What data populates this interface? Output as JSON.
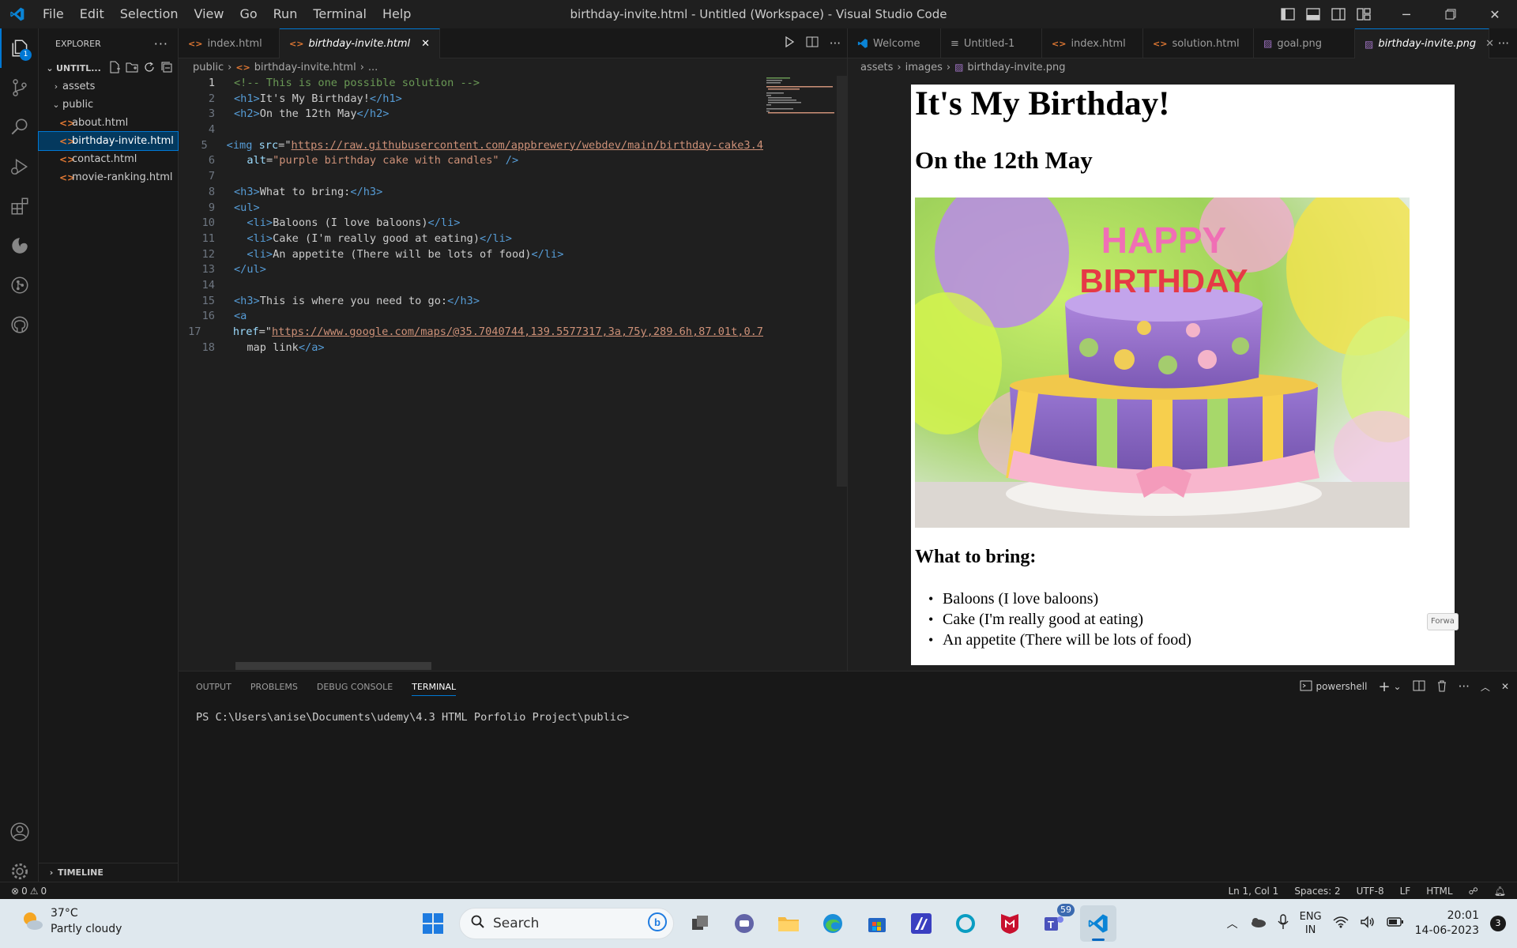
{
  "window": {
    "title": "birthday-invite.html - Untitled (Workspace) - Visual Studio Code",
    "menu": [
      "File",
      "Edit",
      "Selection",
      "View",
      "Go",
      "Run",
      "Terminal",
      "Help"
    ]
  },
  "activity": {
    "explorer_badge": "1"
  },
  "sidebar": {
    "title": "EXPLORER",
    "workspace": "UNTITL...",
    "tree": [
      {
        "label": "assets",
        "type": "folder"
      },
      {
        "label": "public",
        "type": "folder-open"
      },
      {
        "label": "about.html",
        "type": "file"
      },
      {
        "label": "birthday-invite.html",
        "type": "file",
        "selected": true
      },
      {
        "label": "contact.html",
        "type": "file"
      },
      {
        "label": "movie-ranking.html",
        "type": "file"
      }
    ],
    "timeline": "TIMELINE"
  },
  "left_editor": {
    "tabs": [
      {
        "label": "index.html",
        "dirty": true
      },
      {
        "label": "birthday-invite.html",
        "active": true
      }
    ],
    "breadcrumb": [
      "public",
      "birthday-invite.html",
      "..."
    ],
    "line_numbers": [
      "1",
      "2",
      "3",
      "4",
      "5",
      "6",
      "7",
      "8",
      "9",
      "10",
      "11",
      "12",
      "13",
      "14",
      "15",
      "16",
      "17",
      "18"
    ],
    "code": {
      "l1": "<!-- This is one possible solution -->",
      "l2_open": "<h1>",
      "l2_text": "It's My Birthday!",
      "l2_close": "</h1>",
      "l3_open": "<h2>",
      "l3_text": "On the 12th May",
      "l3_close": "</h2>",
      "l5_tag": "<img",
      "l5_attr": "src",
      "l5_url": "https://raw.githubusercontent.com/appbrewery/webdev/main/birthday-cake3.4",
      "l6_attr": "alt",
      "l6_val": "\"purple birthday cake with candles\"",
      "l6_close": " />",
      "l8_open": "<h3>",
      "l8_text": "What to bring:",
      "l8_close": "</h3>",
      "l9": "<ul>",
      "l10_open": "<li>",
      "l10_text": "Baloons (I love baloons)",
      "l10_close": "</li>",
      "l11_open": "<li>",
      "l11_text": "Cake (I'm really good at eating)",
      "l11_close": "</li>",
      "l12_open": "<li>",
      "l12_text": "An appetite (There will be lots of food)",
      "l12_close": "</li>",
      "l13": "</ul>",
      "l15_open": "<h3>",
      "l15_text": "This is where you need to go:",
      "l15_close": "</h3>",
      "l16": "<a",
      "l17_attr": "href",
      "l17_url": "https://www.google.com/maps/@35.7040744,139.5577317,3a,75y,289.6h,87.01t,0.7",
      "l18_text": "map link",
      "l18_close": "</a>"
    }
  },
  "right_editor": {
    "tabs": [
      {
        "label": "Welcome"
      },
      {
        "label": "Untitled-1"
      },
      {
        "label": "index.html",
        "dirty": true
      },
      {
        "label": "solution.html"
      },
      {
        "label": "goal.png"
      },
      {
        "label": "birthday-invite.png",
        "active": true
      }
    ],
    "breadcrumb": [
      "assets",
      "images",
      "birthday-invite.png"
    ],
    "preview": {
      "h1": "It's My Birthday!",
      "h2": "On the 12th May",
      "cake_letters_top": "HAPPY",
      "cake_letters_bottom": "BIRTHDAY",
      "h3": "What to bring:",
      "items": [
        "Baloons (I love baloons)",
        "Cake (I'm really good at eating)",
        "An appetite (There will be lots of food)"
      ],
      "tooltip": "Forwa"
    }
  },
  "panel": {
    "tabs": [
      "OUTPUT",
      "PROBLEMS",
      "DEBUG CONSOLE",
      "TERMINAL"
    ],
    "active_tab": "TERMINAL",
    "shell": "powershell",
    "prompt": "PS C:\\Users\\anise\\Documents\\udemy\\4.3 HTML Porfolio Project\\public>"
  },
  "statusbar": {
    "errors": "0",
    "warnings": "0",
    "position": "Ln 1, Col 1",
    "spaces": "Spaces: 2",
    "encoding": "UTF-8",
    "eol": "LF",
    "language": "HTML"
  },
  "taskbar": {
    "temperature": "37°C",
    "weather": "Partly cloudy",
    "search_placeholder": "Search",
    "teams_badge": "59",
    "lang_top": "ENG",
    "lang_bottom": "IN",
    "time": "20:01",
    "date": "14-06-2023",
    "notifications": "3"
  },
  "colors": {
    "accent": "#0078d4",
    "editor_bg": "#1f1f1f",
    "sidebar_bg": "#181818",
    "taskbar_bg": "#dfe8ee"
  }
}
